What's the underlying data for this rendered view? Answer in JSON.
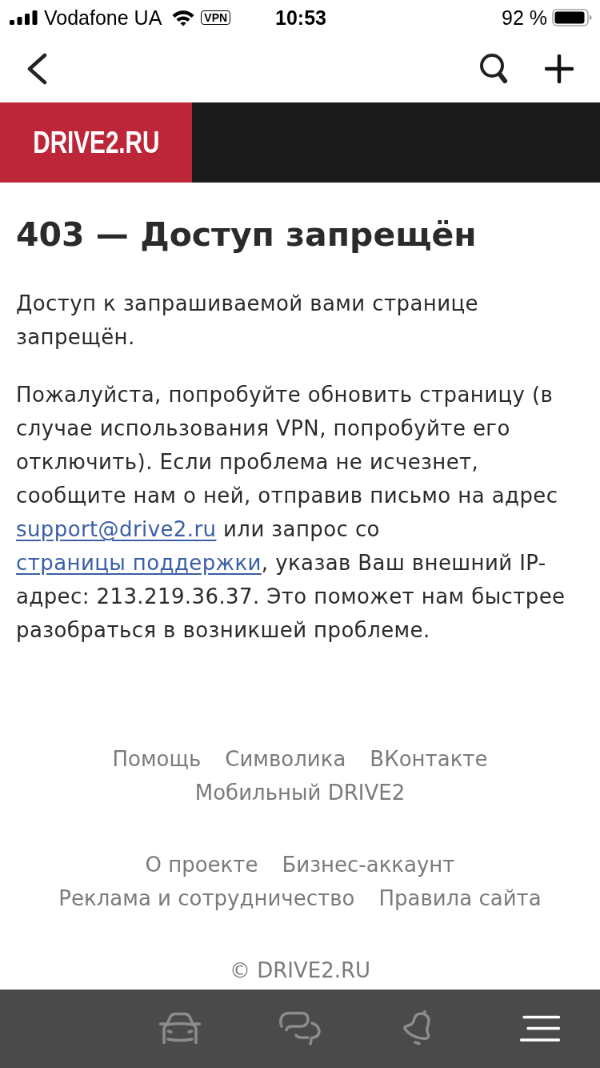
{
  "status_bar": {
    "carrier": "Vodafone UA",
    "vpn": "VPN",
    "time": "10:53",
    "battery": "92 %"
  },
  "brand": {
    "logo": "DRIVE2.RU"
  },
  "title": "403 — Доступ запрещён",
  "intro": "Доступ к запрашиваемой вами странице запрещён.",
  "details": [
    {
      "kind": "text",
      "text": "Пожалуйста, попробуйте обновить страницу (в случае использования VPN, попробуйте его отключить). Если проблема не исчезнет, сообщите нам о ней, отправив письмо на адрес "
    },
    {
      "kind": "link",
      "text": "support@drive2.ru"
    },
    {
      "kind": "text",
      "text": " или запрос со "
    },
    {
      "kind": "link",
      "text": "страницы поддержки"
    },
    {
      "kind": "text",
      "text": ", указав Ваш внешний IP-адрес: 213.219.36.37. Это поможет нам быстрее разобраться в возникшей проблеме."
    }
  ],
  "footer": {
    "link_groups": [
      [
        "Помощь",
        "Символика",
        "ВКонтакте",
        "Мобильный DRIVE2"
      ],
      [
        "О проекте",
        "Бизнес-аккаунт",
        "Реклама и сотрудничество",
        "Правила сайта"
      ]
    ],
    "copyright": "© DRIVE2.RU"
  },
  "tab_bar": [
    {
      "selected": false
    },
    {
      "selected": false
    },
    {
      "selected": false
    },
    {
      "selected": true
    }
  ]
}
